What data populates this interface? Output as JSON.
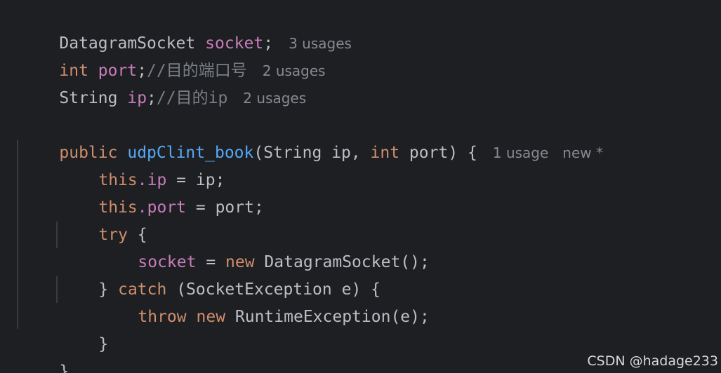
{
  "editor": {
    "lines": [
      {
        "type": "DatagramSocket",
        "field": "socket",
        "punct": ";",
        "hint": "3 usages"
      },
      {
        "type": "int",
        "field": "port",
        "punct": ";",
        "comment": "//目的端口号",
        "hint": "2 usages"
      },
      {
        "type": "String",
        "field": "ip",
        "punct": ";",
        "comment": "//目的ip",
        "hint": "2 usages"
      }
    ],
    "constructor": {
      "modifier": "public",
      "name": "udpClint_book",
      "params_open": "(String ip, ",
      "int_kw": "int",
      "params_close": " port) {",
      "hint_usage": "1 usage",
      "hint_new": "new *"
    },
    "body": {
      "this_kw": "this",
      "assign_ip_field": ".ip",
      "assign_ip_rest": " = ip;",
      "assign_port_field": ".port",
      "assign_port_rest": " = port;",
      "try_kw": "try",
      "try_brace": " {",
      "socket_field": "socket",
      "socket_eq": " = ",
      "new_kw": "new",
      "socket_ctor": " DatagramSocket();",
      "close_brace_catch": "} ",
      "catch_kw": "catch",
      "catch_rest": " (SocketException e) {",
      "throw_kw": "throw",
      "throw_rest": " RuntimeException(e);",
      "inner_close": "}",
      "outer_close": "}"
    }
  },
  "watermark": "CSDN @hadage233",
  "colors": {
    "background": "#1e1f22",
    "keyword": "#cf8e6d",
    "field": "#c77dbb",
    "function": "#56a8f5",
    "text": "#bcbec4",
    "hint": "#868a91"
  }
}
